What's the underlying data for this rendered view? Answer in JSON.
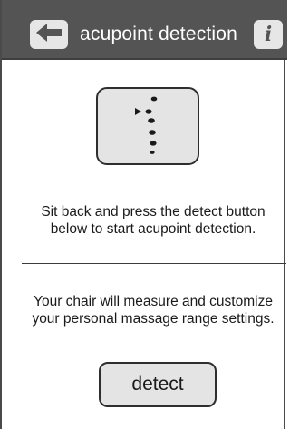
{
  "header": {
    "title": "acupoint detection",
    "back_icon": "back-arrow-icon",
    "info_icon": "info-icon",
    "info_glyph": "i"
  },
  "illustration": {
    "icon": "spine-acupoint-icon"
  },
  "instruction": {
    "lines": [
      "Sit back and press the detect button",
      "below to start acupoint detection."
    ]
  },
  "description": {
    "lines": [
      "Your chair will measure and customize",
      "your personal massage range settings."
    ]
  },
  "detect_button": {
    "label": "detect"
  },
  "colors": {
    "header_bg": "#545454",
    "button_bg": "#e4e4e4",
    "text": "#1a1a1a"
  }
}
